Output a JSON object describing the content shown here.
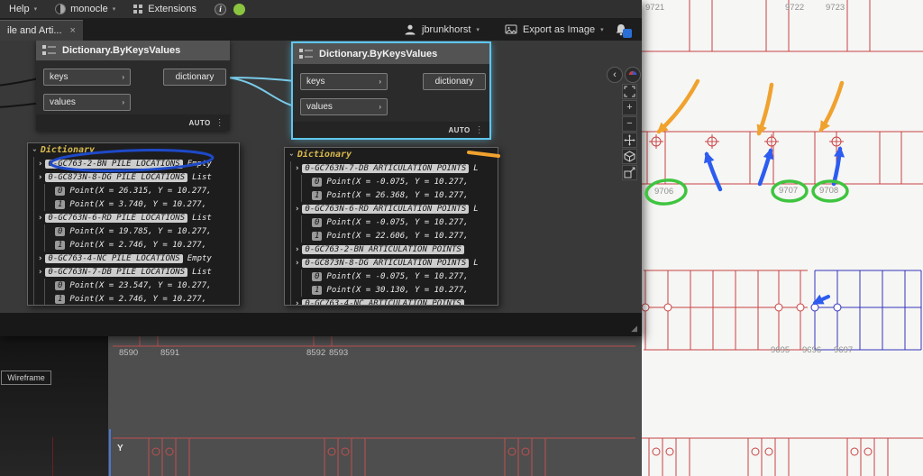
{
  "menu": {
    "help": "Help",
    "monocle": "monocle",
    "extensions": "Extensions"
  },
  "tab": {
    "title": "ile and Arti..."
  },
  "toolbar": {
    "user": "jbrunkhorst",
    "export": "Export as Image"
  },
  "icons": {
    "caret": "▾",
    "close": "×",
    "arrow": "›",
    "dots": "⋮",
    "plus": "+",
    "minus": "−",
    "back": "‹",
    "grip": "◢",
    "info": "i"
  },
  "nodes": [
    {
      "title": "Dictionary.ByKeysValues",
      "inputs": [
        "keys",
        "values"
      ],
      "output": "dictionary",
      "lacing": "AUTO"
    },
    {
      "title": "Dictionary.ByKeysValues",
      "inputs": [
        "keys",
        "values"
      ],
      "output": "dictionary",
      "lacing": "AUTO"
    }
  ],
  "panels": {
    "left": {
      "title": "Dictionary",
      "rows": [
        {
          "type": "key",
          "key": "0-GC763-2-BN PILE LOCATIONS",
          "value": "Empty"
        },
        {
          "type": "key",
          "key": "0-GC873N-8-DG PILE LOCATIONS",
          "value": "List"
        },
        {
          "type": "item",
          "index": "0",
          "value": "Point(X = 26.315, Y = 10.277,"
        },
        {
          "type": "item",
          "index": "1",
          "value": "Point(X = 3.740, Y = 10.277,"
        },
        {
          "type": "key",
          "key": "0-GC763N-6-RD PILE LOCATIONS",
          "value": "List"
        },
        {
          "type": "item",
          "index": "0",
          "value": "Point(X = 19.785, Y = 10.277,"
        },
        {
          "type": "item",
          "index": "1",
          "value": "Point(X = 2.746, Y = 10.277,"
        },
        {
          "type": "key",
          "key": "0-GC763-4-NC PILE LOCATIONS",
          "value": "Empty"
        },
        {
          "type": "key",
          "key": "0-GC763N-7-DB PILE LOCATIONS",
          "value": "List"
        },
        {
          "type": "item",
          "index": "0",
          "value": "Point(X = 23.547, Y = 10.277,"
        },
        {
          "type": "item",
          "index": "1",
          "value": "Point(X = 2.746, Y = 10.277,"
        }
      ]
    },
    "right": {
      "title": "Dictionary",
      "rows": [
        {
          "type": "key",
          "key": "0-GC763N-7-DB ARTICULATION POINTS",
          "value": "L"
        },
        {
          "type": "item",
          "index": "0",
          "value": "Point(X = -0.075, Y = 10.277,"
        },
        {
          "type": "item",
          "index": "1",
          "value": "Point(X = 26.368, Y = 10.277,"
        },
        {
          "type": "key",
          "key": "0-GC763N-6-RD ARTICULATION POINTS",
          "value": "L"
        },
        {
          "type": "item",
          "index": "0",
          "value": "Point(X = -0.075, Y = 10.277,"
        },
        {
          "type": "item",
          "index": "1",
          "value": "Point(X = 22.606, Y = 10.277,"
        },
        {
          "type": "key",
          "key": "0-GC763-2-BN ARTICULATION POINTS",
          "value": ""
        },
        {
          "type": "key",
          "key": "0-GC873N-8-DG ARTICULATION POINTS",
          "value": "L"
        },
        {
          "type": "item",
          "index": "0",
          "value": "Point(X = -0.075, Y = 10.277,"
        },
        {
          "type": "item",
          "index": "1",
          "value": "Point(X = 30.130, Y = 10.277,"
        },
        {
          "type": "key",
          "key": "0-GC763-4-NC ARTICULATION POINTS",
          "value": ""
        }
      ]
    }
  },
  "cad": {
    "top_labels": [
      "9721",
      "9722",
      "9723"
    ],
    "green_labels": [
      "9706",
      "9707",
      "9708"
    ],
    "gray_labels": [
      "8590",
      "8591",
      "8592",
      "8593"
    ],
    "mid_labels": [
      "9695",
      "9696",
      "9697"
    ],
    "wireframe": "Wireframe",
    "axis": "Y"
  },
  "colors": {
    "selection_cyan": "#5fc6ec",
    "annotation_orange": "#f0a22e",
    "annotation_blue": "#2d5cf0",
    "annotation_green": "#3fc43f",
    "cad_red": "#c84343",
    "cad_blue": "#3434bd",
    "panel_title_gold": "#d8b94c",
    "badge_blue": "#2a6fd6",
    "menu_green": "#8bc53f"
  }
}
